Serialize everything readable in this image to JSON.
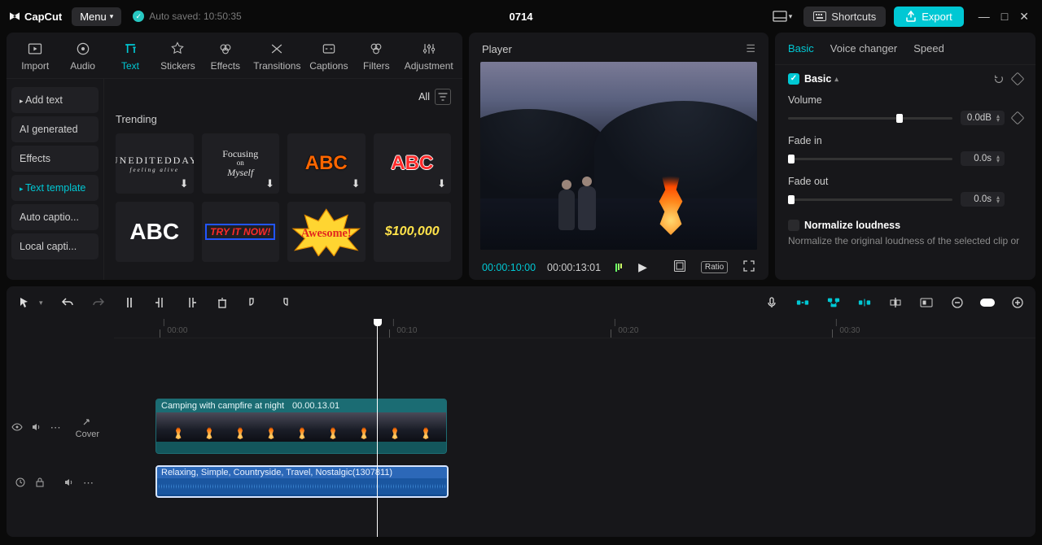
{
  "app": {
    "name": "CapCut"
  },
  "topbar": {
    "menu": "Menu",
    "autosave": "Auto saved: 10:50:35",
    "project_title": "0714",
    "shortcuts": "Shortcuts",
    "export": "Export"
  },
  "media_tabs": {
    "import": "Import",
    "audio": "Audio",
    "text": "Text",
    "stickers": "Stickers",
    "effects": "Effects",
    "transitions": "Transitions",
    "captions": "Captions",
    "filters": "Filters",
    "adjustment": "Adjustment"
  },
  "side_list": {
    "add_text": "Add text",
    "ai_generated": "AI generated",
    "effects": "Effects",
    "text_template": "Text template",
    "auto_captions": "Auto captio...",
    "local_captions": "Local capti..."
  },
  "gallery": {
    "filter_all": "All",
    "trending": "Trending",
    "t1": "UNEDITEDDAY",
    "t1s": "feeling alive",
    "t2a": "Focusing",
    "t2b": "on",
    "t2c": "Myself",
    "abc": "ABC",
    "try": "TRY IT NOW!",
    "awesome": "Awesome!",
    "money": "$100,000"
  },
  "player": {
    "title": "Player",
    "tc_current": "00:00:10:00",
    "tc_total": "00:00:13:01",
    "ratio": "Ratio"
  },
  "right": {
    "tab_basic": "Basic",
    "tab_voice": "Voice changer",
    "tab_speed": "Speed",
    "sect_basic": "Basic",
    "volume": "Volume",
    "volume_val": "0.0dB",
    "fade_in": "Fade in",
    "fade_in_val": "0.0s",
    "fade_out": "Fade out",
    "fade_out_val": "0.0s",
    "normalize": "Normalize loudness",
    "normalize_desc": "Normalize the original loudness of the selected clip or"
  },
  "ruler": {
    "t0": "00:00",
    "t10": "00:10",
    "t20": "00:20",
    "t30": "00:30"
  },
  "track": {
    "cover": "Cover",
    "clip_title": "Camping with campfire at night",
    "clip_dur": "00.00.13.01",
    "audio_title": "Relaxing, Simple, Countryside, Travel, Nostalgic(1307811)"
  }
}
